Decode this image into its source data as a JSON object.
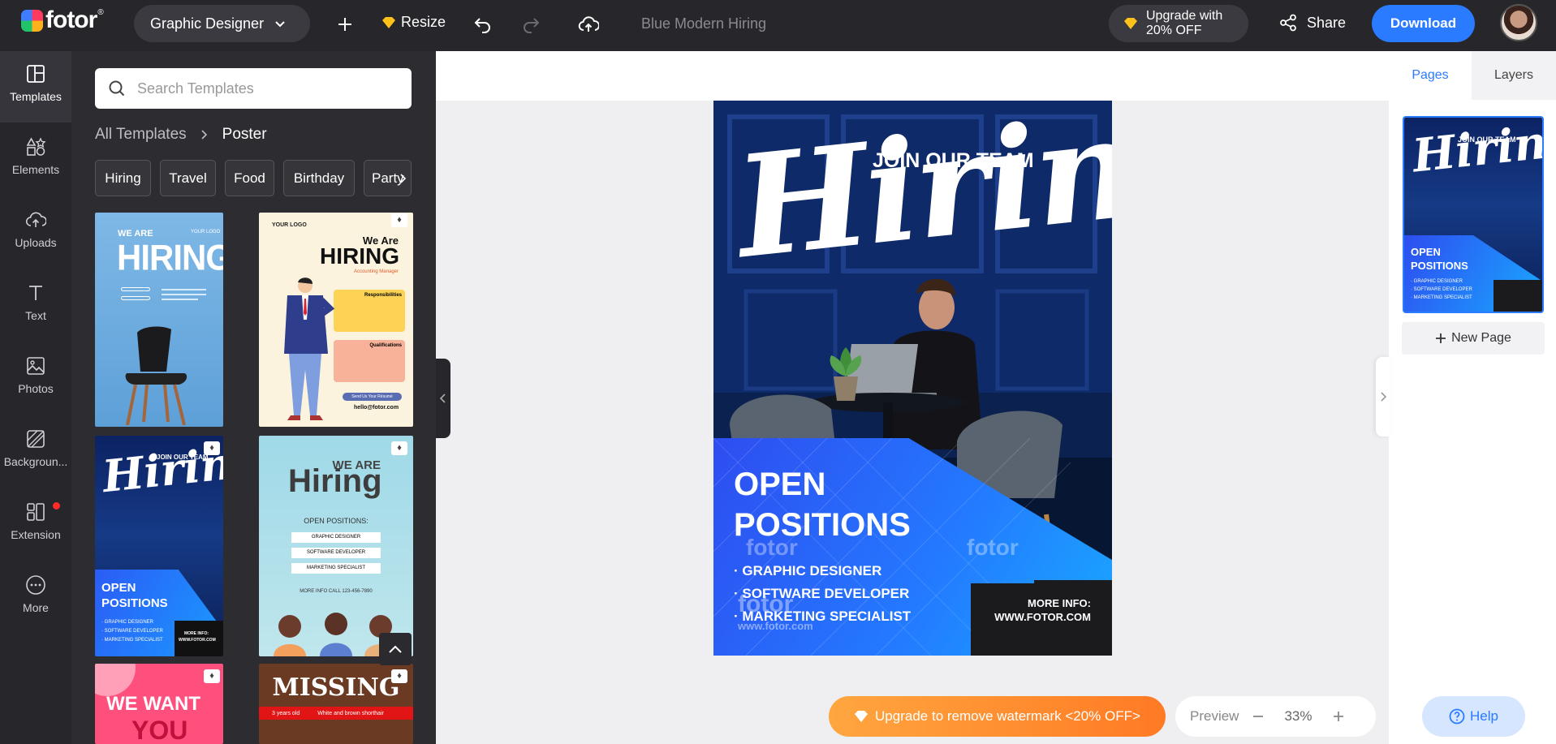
{
  "app": {
    "logo_text": "fotor",
    "logo_reg": "®",
    "role_label": "Graphic Designer",
    "resize_label": "Resize",
    "doc_title": "Blue Modern Hiring",
    "upgrade_line1": "Upgrade with",
    "upgrade_line2": "20% OFF",
    "share_label": "Share",
    "download_label": "Download"
  },
  "nav": [
    {
      "label": "Templates",
      "icon": "templates-icon",
      "active": true
    },
    {
      "label": "Elements",
      "icon": "elements-icon"
    },
    {
      "label": "Uploads",
      "icon": "uploads-icon"
    },
    {
      "label": "Text",
      "icon": "text-icon"
    },
    {
      "label": "Photos",
      "icon": "photos-icon"
    },
    {
      "label": "Backgroun...",
      "icon": "background-icon"
    },
    {
      "label": "Extension",
      "icon": "extension-icon"
    },
    {
      "label": "More",
      "icon": "more-icon"
    }
  ],
  "panel": {
    "search_placeholder": "Search Templates",
    "crumb_root": "All Templates",
    "crumb_current": "Poster",
    "chips": [
      "Hiring",
      "Travel",
      "Food",
      "Birthday",
      "Party"
    ]
  },
  "thumbs": {
    "t1": {
      "line1": "WE ARE",
      "line2": "HIRING!",
      "logo": "YOUR LOGO"
    },
    "t2": {
      "logo": "YOUR LOGO",
      "line1": "We Are",
      "line2": "HIRING",
      "sub": "Accounting Manager",
      "box1": "Responsibilities",
      "box2": "Qualifications",
      "button": "Send Us Your Résumé",
      "email": "hello@fotor.com"
    },
    "t3": {
      "script": "Hiring",
      "top": "JOIN OUR TEAM",
      "open1": "OPEN",
      "open2": "POSITIONS",
      "r1": "· GRAPHIC DESIGNER",
      "r2": "· SOFTWARE DEVELOPER",
      "r3": "· MARKETING SPECIALIST",
      "more": "MORE INFO:",
      "url": "WWW.FOTOR.COM"
    },
    "t4": {
      "line1": "WE ARE",
      "line2": "Hiring",
      "open": "OPEN POSITIONS:",
      "r1": "GRAPHIC DESIGNER",
      "r2": "SOFTWARE DEVELOPER",
      "r3": "MARKETING SPECIALIST",
      "call": "MORE INFO CALL 123-456-7890"
    },
    "t5": {
      "text": "WE WANT",
      "text2": "YOU"
    },
    "t6": {
      "text": "MISSING",
      "band1": "3 years old",
      "band2": "White and brown shorthair"
    }
  },
  "poster": {
    "join": "JOIN OUR TEAM",
    "script": "Hiring",
    "open1": "OPEN",
    "open2": "POSITIONS",
    "roles": [
      "· GRAPHIC DESIGNER",
      "· SOFTWARE DEVELOPER",
      "· MARKETING SPECIALIST"
    ],
    "more": "MORE INFO:",
    "url": "WWW.FOTOR.COM",
    "wm_site": "www.fotor.com",
    "wm_brand": "fotor"
  },
  "right": {
    "tab_pages": "Pages",
    "tab_layers": "Layers",
    "new_page": "New Page"
  },
  "bottom": {
    "upgrade": "Upgrade to remove watermark <20% OFF>",
    "preview": "Preview",
    "zoom": "33%",
    "help": "Help"
  },
  "colors": {
    "accent": "#2a7bff",
    "topbar": "#26262b",
    "orange": "#ff8a2a"
  }
}
